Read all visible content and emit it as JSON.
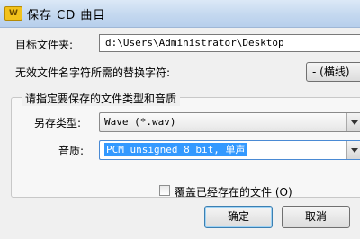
{
  "window": {
    "app_icon_label": "W",
    "title": "保存 CD 曲目"
  },
  "target_folder": {
    "label": "目标文件夹:",
    "value": "d:\\Users\\Administrator\\Desktop"
  },
  "replacement_char": {
    "label": "无效文件名字符所需的替换字符:",
    "button_label": "- (横线)"
  },
  "file_format_group": {
    "title": "请指定要保存的文件类型和音质",
    "save_type": {
      "label": "另存类型:",
      "value": "Wave (*.wav)"
    },
    "quality": {
      "label": "音质:",
      "value": "PCM unsigned 8 bit, 单声"
    }
  },
  "overwrite": {
    "checked": false,
    "label": "覆盖已经存在的文件 (O)"
  },
  "buttons": {
    "ok_label": "确定",
    "cancel_label": "取消"
  }
}
